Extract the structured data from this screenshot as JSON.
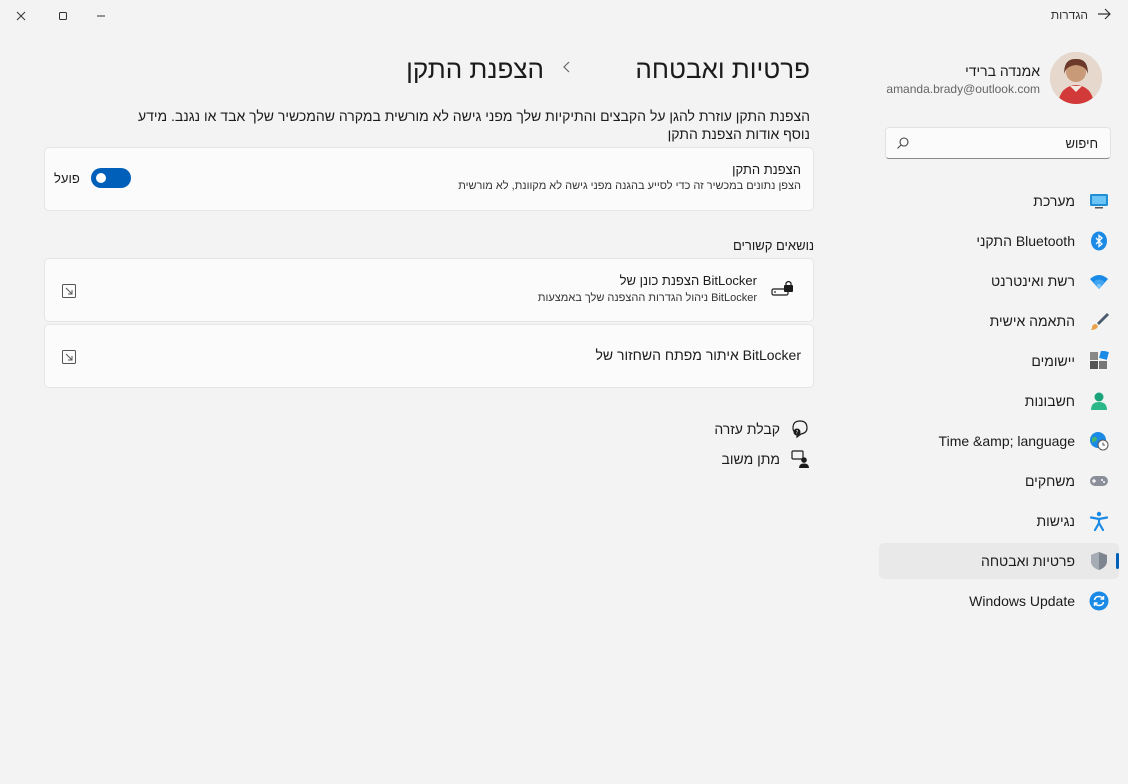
{
  "window": {
    "title": "הגדרות"
  },
  "user": {
    "name": "אמנדה ברידי",
    "email": "amanda.brady@outlook.com"
  },
  "search": {
    "placeholder": "חיפוש"
  },
  "sidebar": {
    "items": [
      {
        "label": "מערכת",
        "icon": "display-icon"
      },
      {
        "label": "התקני Bluetooth",
        "icon": "bluetooth-icon"
      },
      {
        "label": "רשת ואינטרנט",
        "icon": "wifi-icon"
      },
      {
        "label": "התאמה אישית",
        "icon": "brush-icon"
      },
      {
        "label": "יישומים",
        "icon": "apps-icon"
      },
      {
        "label": "חשבונות",
        "icon": "person-icon"
      },
      {
        "label": "Time &amp; language",
        "icon": "globe-clock-icon"
      },
      {
        "label": "משחקים",
        "icon": "gamepad-icon"
      },
      {
        "label": "נגישות",
        "icon": "accessibility-icon"
      },
      {
        "label": "פרטיות ואבטחה",
        "icon": "shield-icon",
        "active": true
      },
      {
        "label": "Windows Update",
        "icon": "sync-icon"
      }
    ]
  },
  "breadcrumb": {
    "parent": "פרטיות ואבטחה",
    "separator": ">",
    "current": "הצפנת התקן"
  },
  "description": {
    "text": "הצפנת התקן עוזרת להגן על הקבצים והתיקיות שלך מפני גישה לא מורשית במקרה שהמכשיר שלך אבד או נגנב. מידע",
    "link": "נוסף אודות הצפנת התקן"
  },
  "encryption_card": {
    "title": "הצפנת התקן",
    "subtitle": "הצפן נתונים במכשיר זה כדי לסייע בהגנה מפני גישה לא מקוונת, לא מורשית",
    "toggle_label": "פועל",
    "toggle_on": true
  },
  "related": {
    "title": "נושאים קשורים",
    "items": [
      {
        "title": "הצפנת כונן של BitLocker",
        "subtitle": "ניהול הגדרות ההצפנה שלך באמצעות BitLocker"
      },
      {
        "title": "איתור מפתח השחזור של BitLocker",
        "subtitle": ""
      }
    ]
  },
  "help": {
    "get_help": "קבלת עזרה",
    "feedback": "מתן משוב"
  },
  "colors": {
    "accent": "#005fb8",
    "background": "#f3f3f3",
    "card": "#fbfbfb"
  }
}
